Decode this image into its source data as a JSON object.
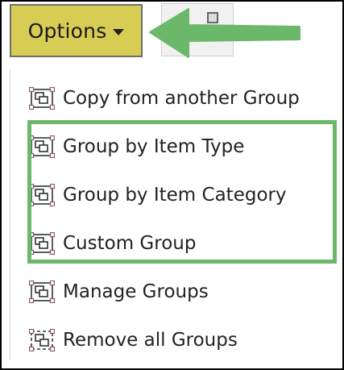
{
  "toolbar": {
    "options_label": "Options"
  },
  "menu": {
    "items": [
      {
        "label": "Copy from another Group",
        "icon": "group-frame-icon"
      },
      {
        "label": "Group by Item Type",
        "icon": "group-frame-icon"
      },
      {
        "label": "Group by Item Category",
        "icon": "group-frame-icon"
      },
      {
        "label": "Custom Group",
        "icon": "group-frame-icon"
      },
      {
        "label": "Manage Groups",
        "icon": "group-frame-icon"
      },
      {
        "label": "Remove all Groups",
        "icon": "ungroup-frame-icon"
      }
    ]
  },
  "colors": {
    "options_bg": "#d7cd54",
    "annotation_green": "#6cb86a",
    "frame_border": "#000000"
  }
}
